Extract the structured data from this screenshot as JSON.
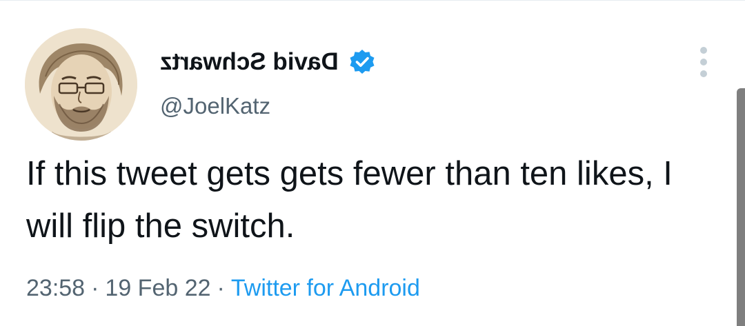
{
  "tweet": {
    "author": {
      "display_name": "David Schwartz",
      "handle": "@JoelKatz",
      "verified": true
    },
    "text": "If this tweet gets gets fewer than ten likes, I will flip the switch.",
    "meta": {
      "time": "23:58",
      "date": "19 Feb 22",
      "separator": "·",
      "source": "Twitter for Android"
    }
  },
  "icons": {
    "verified": "verified-badge-icon",
    "more": "more-options-vertical-icon"
  },
  "colors": {
    "accent": "#1d9bf0",
    "text_primary": "#0f1419",
    "text_secondary": "#536471",
    "scrollbar": "#7f7f7f"
  }
}
